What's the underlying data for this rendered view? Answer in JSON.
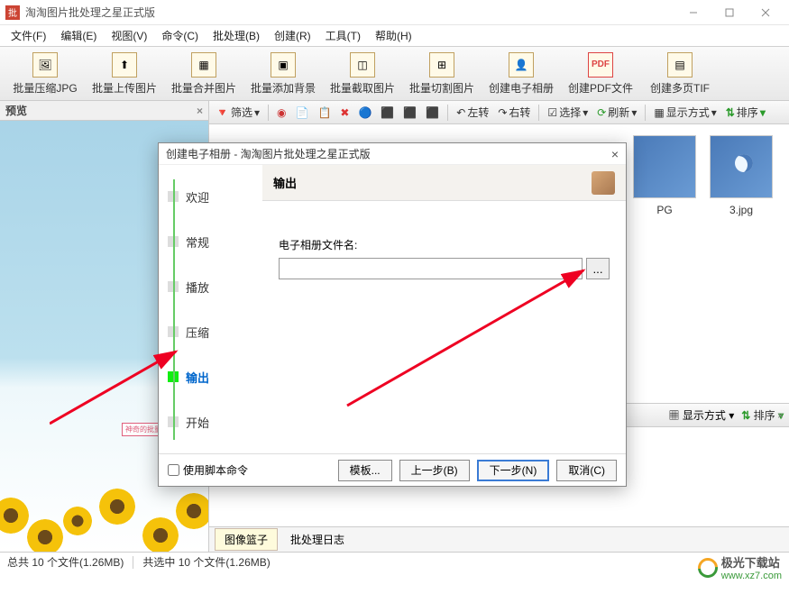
{
  "window": {
    "title": "淘淘图片批处理之星正式版"
  },
  "menu": {
    "file": "文件(F)",
    "edit": "编辑(E)",
    "view": "视图(V)",
    "cmd": "命令(C)",
    "batch": "批处理(B)",
    "create": "创建(R)",
    "tools": "工具(T)",
    "help": "帮助(H)"
  },
  "toolbar": {
    "compress": "批量压缩JPG",
    "upload": "批量上传图片",
    "merge": "批量合并图片",
    "addbg": "批量添加背景",
    "crop": "批量截取图片",
    "cut": "批量切割图片",
    "album": "创建电子相册",
    "pdf": "创建PDF文件",
    "tif": "创建多页TIF"
  },
  "preview": {
    "header": "预览",
    "watermark": "神奇的批量图片下载软件"
  },
  "subtoolbar": {
    "filter": "筛选",
    "rotleft": "左转",
    "rotright": "右转",
    "select": "选择",
    "refresh": "刷新",
    "viewmode": "显示方式",
    "sort": "排序"
  },
  "thumbs": {
    "t1": "PG",
    "t2": "3.jpg"
  },
  "tabs": {
    "basket": "图像篮子",
    "log": "批处理日志"
  },
  "status": {
    "left": "总共 10 个文件(1.26MB)",
    "right": "共选中 10 个文件(1.26MB)"
  },
  "modal": {
    "title": "创建电子相册 - 淘淘图片批处理之星正式版",
    "steps": {
      "welcome": "欢迎",
      "general": "常规",
      "play": "播放",
      "compress": "压缩",
      "output": "输出",
      "start": "开始"
    },
    "header": "输出",
    "field_label": "电子相册文件名:",
    "browse": "...",
    "template": "模板...",
    "prev": "上一步(B)",
    "next": "下一步(N)",
    "cancel": "取消(C)",
    "script_chk": "使用脚本命令"
  },
  "watermark_site": {
    "name": "极光下载站",
    "url": "www.xz7.com"
  }
}
